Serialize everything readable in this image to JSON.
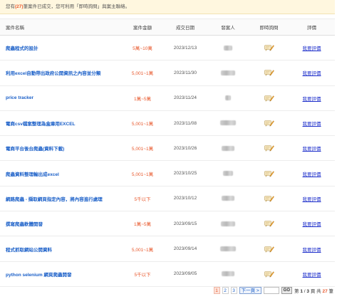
{
  "notice": {
    "prefix": "您有",
    "count": "(27)",
    "suffix": "筆案件已成交，您可利用「即時詢問」與案主聯絡。"
  },
  "table": {
    "headers": [
      "案件名稱",
      "案件金額",
      "成交日期",
      "發案人",
      "即時詢問",
      "評價"
    ],
    "rows": [
      {
        "name": "爬蟲程式的設計",
        "amount": "5萬~10萬",
        "date": "2023/12/13",
        "rate": "我要評價",
        "blur_w": 12
      },
      {
        "name": "利用excel自動帶出政府公開資訊之內容並分類",
        "amount": "5,001~1萬",
        "date": "2023/11/30",
        "rate": "我要評價",
        "blur_w": 20
      },
      {
        "name": "price tracker",
        "amount": "1萬~5萬",
        "date": "2023/11/24",
        "rate": "我要評價",
        "blur_w": 8
      },
      {
        "name": "電商csv檔案整理為盒庫用EXCEL",
        "amount": "5,001~1萬",
        "date": "2023/11/08",
        "rate": "我要評價",
        "blur_w": 22
      },
      {
        "name": "電商平台後台爬蟲(資料下載)",
        "amount": "5,001~1萬",
        "date": "2023/10/26",
        "rate": "我要評價",
        "blur_w": 18
      },
      {
        "name": "爬蟲資料整理輸出成excel",
        "amount": "5,001~1萬",
        "date": "2023/10/25",
        "rate": "我要評價",
        "blur_w": 14
      },
      {
        "name": "網路爬蟲 - 擷取網頁指定內容，將內容進行處理",
        "amount": "5千以下",
        "date": "2023/10/12",
        "rate": "我要評價",
        "blur_w": 18
      },
      {
        "name": "撰寫爬蟲軟體開發",
        "amount": "1萬~5萬",
        "date": "2023/09/15",
        "rate": "我要評價",
        "blur_w": 20
      },
      {
        "name": "程式抓取網站公開資料",
        "amount": "5,001~1萬",
        "date": "2023/09/14",
        "rate": "我要評價",
        "blur_w": 22
      },
      {
        "name": "python selenium 網頁爬蟲開發",
        "amount": "5千以下",
        "date": "2023/09/05",
        "rate": "我要評價",
        "blur_w": 18
      }
    ]
  },
  "pager": {
    "pages": [
      "1",
      "2",
      "3"
    ],
    "current": "1",
    "next_label": "下一頁 >",
    "go_label": "GO",
    "info_prefix": "第",
    "info_page": "1",
    "info_mid": "/",
    "info_total": "3",
    "info_pages_word": "頁 共",
    "info_count": "27",
    "info_suffix": "筆"
  },
  "colors": {
    "accent": "#e8582c",
    "link": "#1a5fc8",
    "notice_bg": "#fff7df"
  },
  "icons": {
    "inquiry": "chat-pencil-icon"
  }
}
